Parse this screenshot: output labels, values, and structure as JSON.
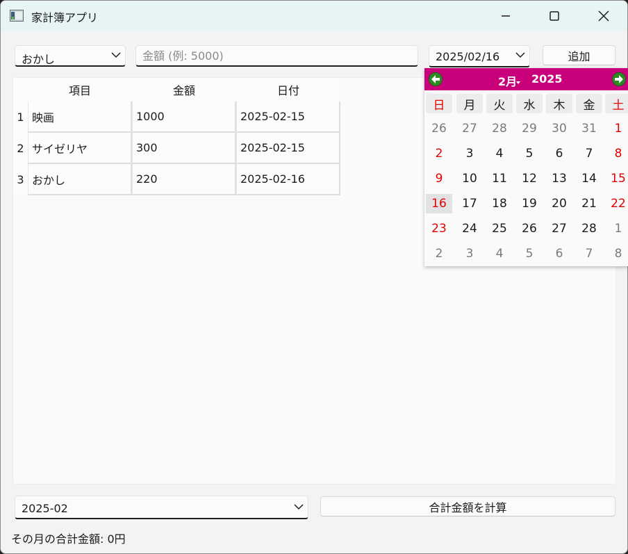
{
  "window": {
    "title": "家計簿アプリ"
  },
  "toolbar": {
    "category_value": "おかし",
    "amount_placeholder": "金額 (例: 5000)",
    "date_value": "2025/02/16",
    "add_label": "追加"
  },
  "table": {
    "headers": [
      "項目",
      "金額",
      "日付"
    ],
    "row_numbers": [
      "1",
      "2",
      "3"
    ],
    "rows": [
      [
        "映画",
        "1000",
        "2025-02-15"
      ],
      [
        "サイゼリヤ",
        "300",
        "2025-02-15"
      ],
      [
        "おかし",
        "220",
        "2025-02-16"
      ]
    ]
  },
  "calendar": {
    "month_label": "2月",
    "year_label": "2025",
    "header_color": "#c8007a",
    "selected_day": "16",
    "weekdays": [
      "日",
      "月",
      "火",
      "水",
      "木",
      "金",
      "土"
    ],
    "weeks": [
      [
        "26",
        "27",
        "28",
        "29",
        "30",
        "31",
        "1"
      ],
      [
        "2",
        "3",
        "4",
        "5",
        "6",
        "7",
        "8"
      ],
      [
        "9",
        "10",
        "11",
        "12",
        "13",
        "14",
        "15"
      ],
      [
        "16",
        "17",
        "18",
        "19",
        "20",
        "21",
        "22"
      ],
      [
        "23",
        "24",
        "25",
        "26",
        "27",
        "28",
        "1"
      ],
      [
        "2",
        "3",
        "4",
        "5",
        "6",
        "7",
        "8"
      ]
    ]
  },
  "footer": {
    "month_value": "2025-02",
    "calc_label": "合計金額を計算",
    "total_text": "その月の合計金額: 0円"
  }
}
